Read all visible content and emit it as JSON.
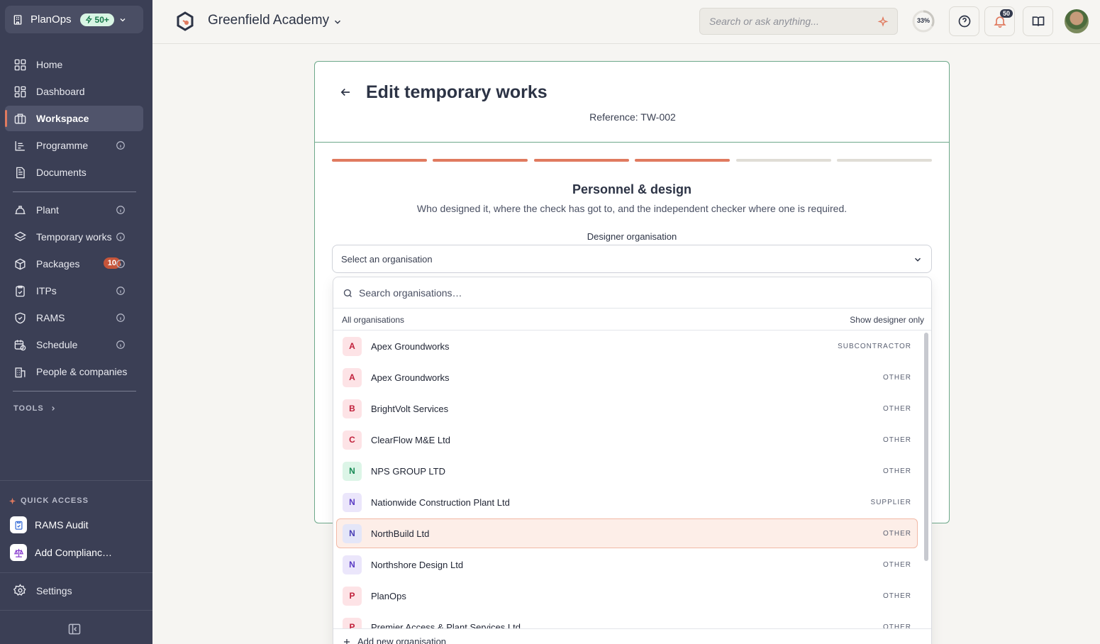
{
  "sidebar": {
    "org_name": "PlanOps",
    "org_badge": "50+",
    "nav": [
      {
        "label": "Home",
        "icon": "grid-icon"
      },
      {
        "label": "Dashboard",
        "icon": "dashboard-icon"
      },
      {
        "label": "Workspace",
        "icon": "workspace-icon"
      },
      {
        "label": "Programme",
        "icon": "programme-icon"
      },
      {
        "label": "Documents",
        "icon": "document-icon"
      },
      {
        "label": "Plant",
        "icon": "hardhat-icon"
      },
      {
        "label": "Temporary works",
        "icon": "layers-icon"
      },
      {
        "label": "Packages",
        "icon": "package-icon",
        "badge": "10"
      },
      {
        "label": "ITPs",
        "icon": "clipboard-check-icon"
      },
      {
        "label": "RAMS",
        "icon": "shield-check-icon"
      },
      {
        "label": "Schedule",
        "icon": "calendar-clock-icon"
      },
      {
        "label": "People & companies",
        "icon": "building-icon"
      }
    ],
    "tools_label": "TOOLS",
    "quick_access_label": "QUICK ACCESS",
    "quick_access": [
      {
        "label": "RAMS Audit"
      },
      {
        "label": "Add Complianc…"
      }
    ],
    "settings_label": "Settings"
  },
  "topbar": {
    "project": "Greenfield Academy",
    "search_placeholder": "Search or ask anything...",
    "progress": "33%",
    "notifications": "50"
  },
  "card": {
    "title": "Edit temporary works",
    "reference": "Reference: TW-002",
    "steps_done": 4,
    "steps_total": 6,
    "section_title": "Personnel & design",
    "section_subtitle": "Who designed it, where the check has got to, and the independent checker where one is required.",
    "field_label": "Designer organisation",
    "select_value": "Select an organisation"
  },
  "dropdown": {
    "search_placeholder": "Search organisations…",
    "filter_left": "All organisations",
    "filter_right": "Show designer only",
    "items": [
      {
        "letter": "A",
        "name": "Apex Groundworks",
        "type": "SUBCONTRACTOR",
        "color": "#c01f3a",
        "bg": "#fde3e6"
      },
      {
        "letter": "A",
        "name": "Apex Groundworks",
        "type": "OTHER",
        "color": "#c01f3a",
        "bg": "#fde3e6"
      },
      {
        "letter": "B",
        "name": "BrightVolt Services",
        "type": "OTHER",
        "color": "#c01f3a",
        "bg": "#fde3e6"
      },
      {
        "letter": "C",
        "name": "ClearFlow M&E Ltd",
        "type": "OTHER",
        "color": "#c01f3a",
        "bg": "#fde3e6"
      },
      {
        "letter": "N",
        "name": "NPS GROUP LTD",
        "type": "OTHER",
        "color": "#178a55",
        "bg": "#dcf5e7"
      },
      {
        "letter": "N",
        "name": "Nationwide Construction Plant Ltd",
        "type": "SUPPLIER",
        "color": "#5b3cc4",
        "bg": "#ebe6fb"
      },
      {
        "letter": "N",
        "name": "NorthBuild Ltd",
        "type": "OTHER",
        "color": "#4a3fb5",
        "bg": "#e4e6f8"
      },
      {
        "letter": "N",
        "name": "Northshore Design Ltd",
        "type": "OTHER",
        "color": "#5b3cc4",
        "bg": "#ebe6fb"
      },
      {
        "letter": "P",
        "name": "PlanOps",
        "type": "OTHER",
        "color": "#c01f3a",
        "bg": "#fde3e6"
      },
      {
        "letter": "P",
        "name": "Premier Access & Plant Services Ltd",
        "type": "OTHER",
        "color": "#c01f3a",
        "bg": "#fde3e6"
      }
    ],
    "highlighted_index": 6,
    "add_label": "Add new organisation"
  },
  "colors": {
    "accent": "#e07a5f",
    "sidebar": "#3b3f55",
    "card_border": "#6da88a"
  }
}
